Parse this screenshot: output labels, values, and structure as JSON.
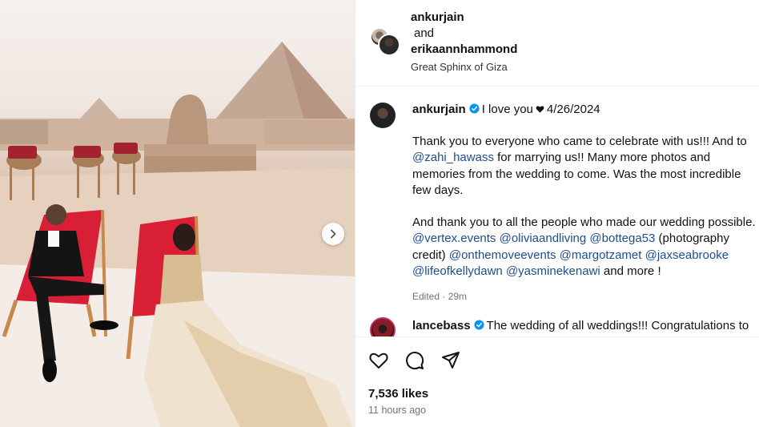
{
  "post": {
    "header": {
      "user1": "ankurjain",
      "and": "and",
      "user2": "erikaannhammond",
      "location": "Great Sphinx of Giza"
    },
    "caption": {
      "username": "ankurjain",
      "line1_text_before_heart": "I love you",
      "line1_text_after_heart": "4/26/2024",
      "para1_part1": "Thank you to everyone who came to celebrate with us!!! And to",
      "para1_mention": "@zahi_hawass",
      "para1_part2": "for marrying us!! Many more photos and memories from the wedding to come. Was the most incredible few days.",
      "para2_part1": "And thank you to all the people who made our wedding possible.",
      "mentions": [
        "@vertex.events",
        "@oliviaandliving",
        "@bottega53"
      ],
      "photo_credit": "(photography credit)",
      "mentions2": [
        "@onthemoveevents",
        "@margotzamet",
        "@jaxseabrooke",
        "@lifeofkellydawn",
        "@yasminekenawi"
      ],
      "and_more": "and more !",
      "edited": "Edited · 29m"
    },
    "comment": {
      "username": "lancebass",
      "text": "The wedding of all weddings!!! Congratulations to"
    },
    "actions": {
      "like_icon": "heart-outline-icon",
      "comment_icon": "speech-bubble-icon",
      "share_icon": "paper-plane-icon"
    },
    "likes": "7,536 likes",
    "time_ago": "11 hours ago"
  },
  "colors": {
    "mention": "#1e4d8c",
    "verified": "#0095f6",
    "secondary_text": "#737373"
  }
}
